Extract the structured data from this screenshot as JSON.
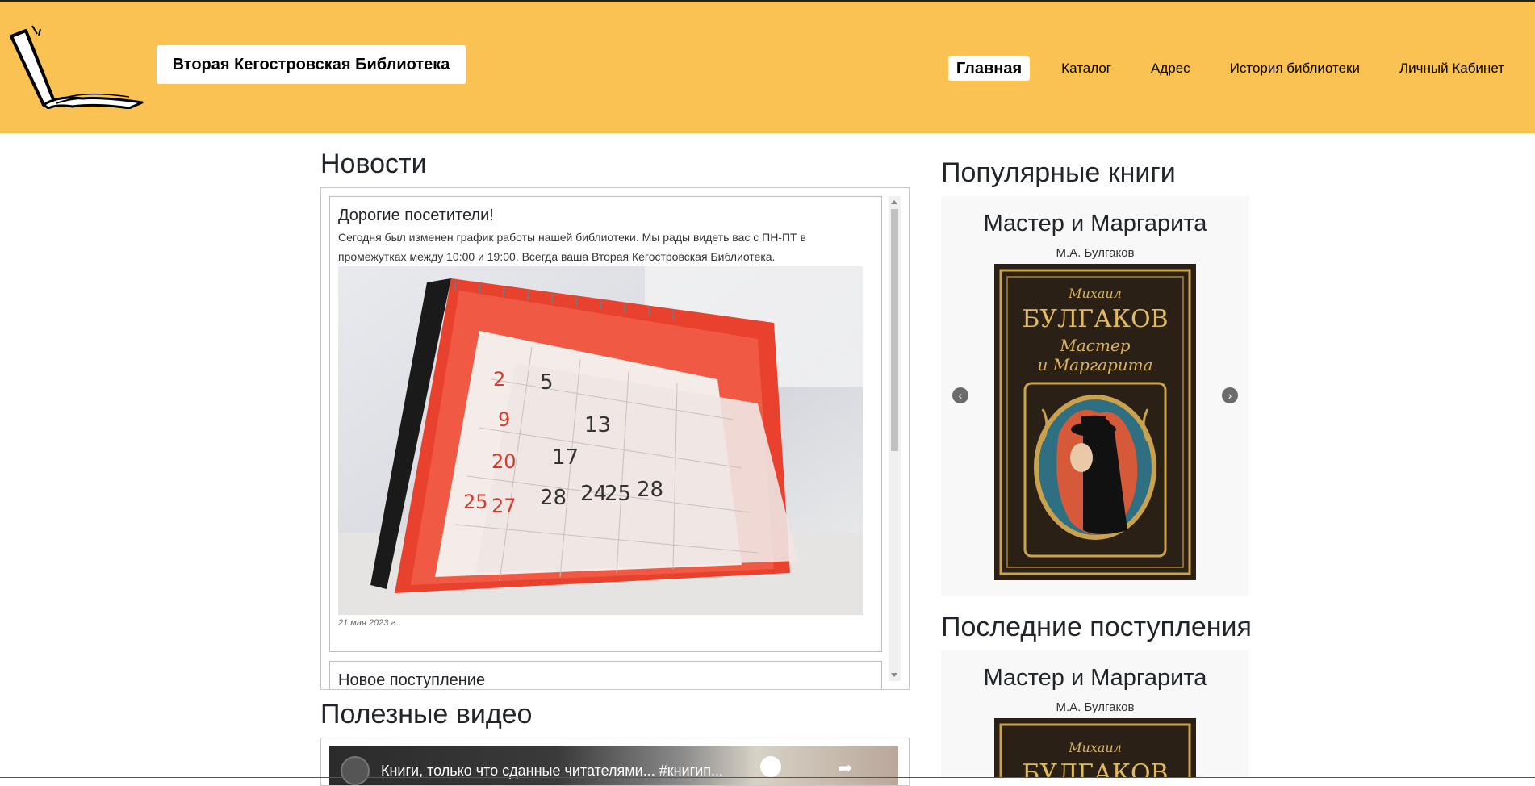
{
  "header": {
    "brand": "Вторая Кегостровская Библиотека",
    "nav": [
      "Главная",
      "Каталог",
      "Адрес",
      "История библиотеки",
      "Личный Кабинет"
    ],
    "accent_color": "#fac252"
  },
  "news": {
    "heading": "Новости",
    "items": [
      {
        "title": "Дорогие посетители!",
        "text": "Сегодня был изменен график работы нашей библиотеки. Мы рады видеть вас с ПН-ПТ в промежутках между 10:00 и 19:00. Всегда ваша Вторая Кегостровская Библиотека.",
        "date": "21 мая 2023 г."
      },
      {
        "title": "Новое поступление"
      }
    ]
  },
  "videos": {
    "heading": "Полезные видео",
    "title": "Книги, только что сданные читателями... #книгип..."
  },
  "popular": {
    "heading": "Популярные книги",
    "book_title": "Мастер и Маргарита",
    "book_author": "М.А. Булгаков",
    "cover_lines": [
      "Михаил",
      "БУЛГАКОВ",
      "Мастер",
      "и Маргарита"
    ]
  },
  "latest": {
    "heading": "Последние поступления",
    "book_title": "Мастер и Маргарита",
    "book_author": "М.А. Булгаков",
    "cover_lines": [
      "Михаил",
      "БУЛГАКОВ"
    ]
  }
}
